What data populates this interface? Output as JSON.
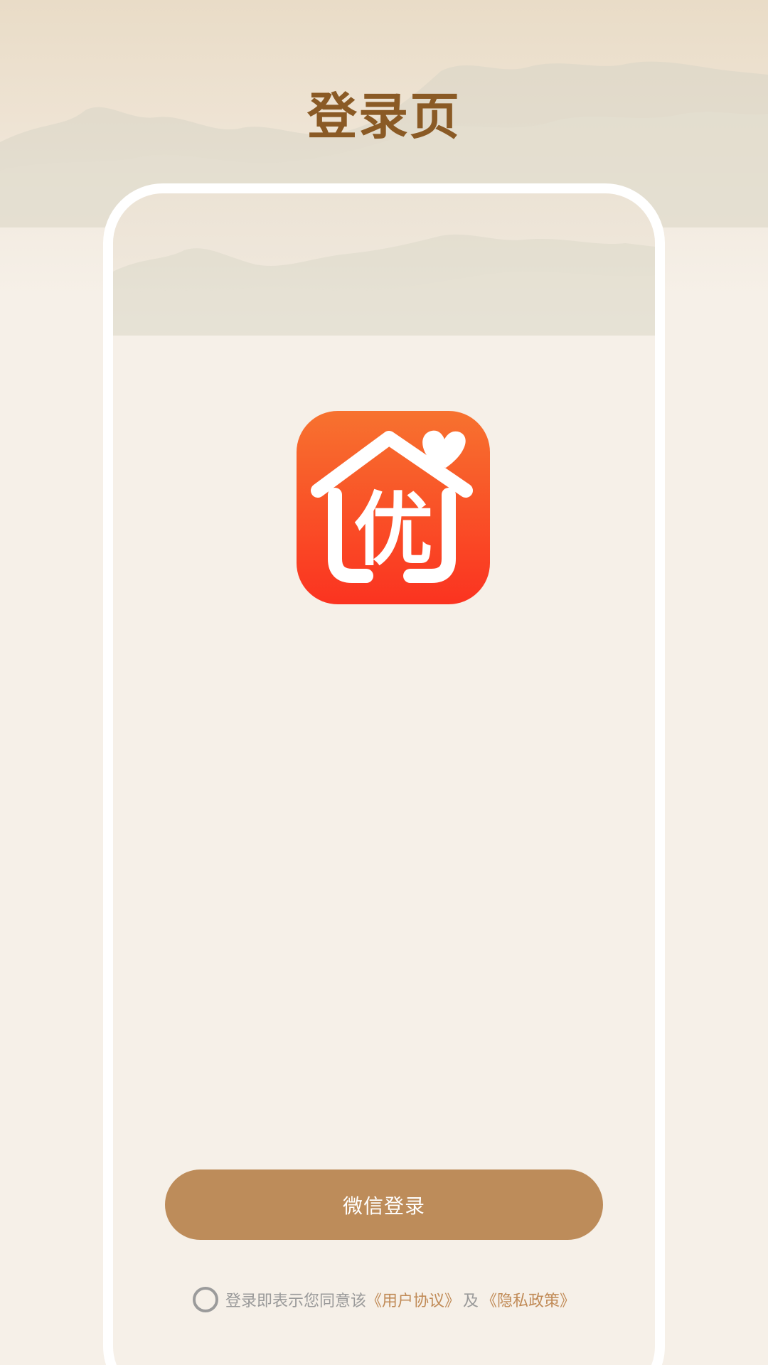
{
  "page": {
    "title": "登录页"
  },
  "logo": {
    "icon": "house-heart-you-icon",
    "glyph": "优",
    "gradient_top": "#f7722f",
    "gradient_bottom": "#fb3320"
  },
  "login": {
    "wechat_button_label": "微信登录",
    "button_color": "#bd8c5a"
  },
  "agreement": {
    "prefix": "登录即表示您同意该",
    "user_agreement": "《用户协议》",
    "conjunction": "及",
    "privacy_policy": "《隐私政策》",
    "checked": false,
    "link_color": "#c08a56"
  }
}
